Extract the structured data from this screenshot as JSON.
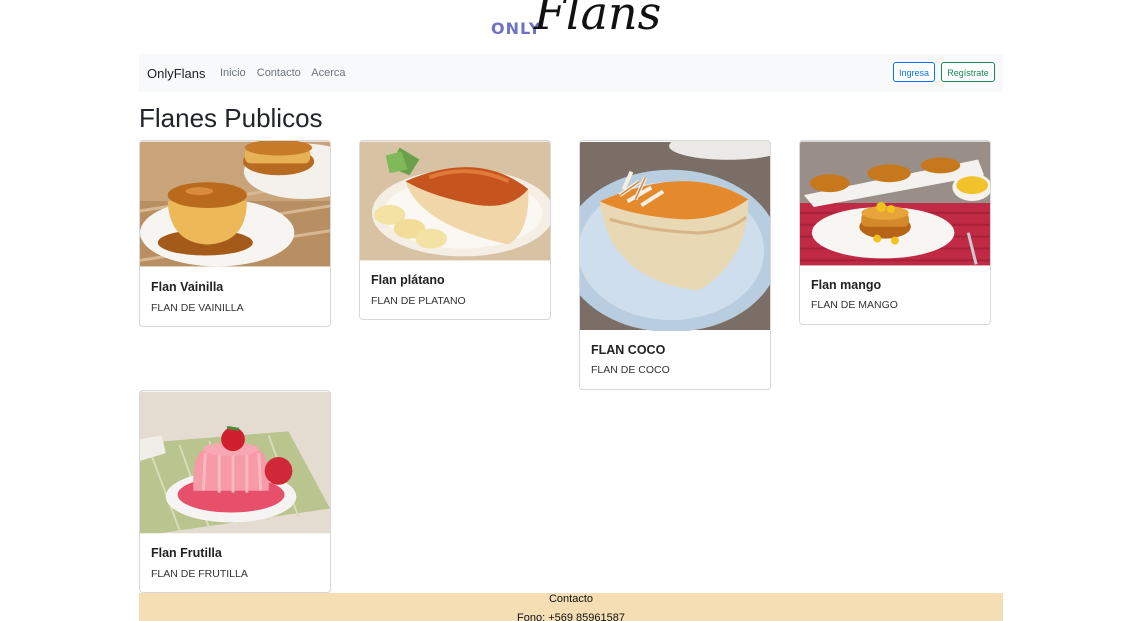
{
  "logo": {
    "only": "ONLY",
    "flans": "Flans"
  },
  "navbar": {
    "brand": "OnlyFlans",
    "links": [
      "Inicio",
      "Contacto",
      "Acerca"
    ],
    "login": "Ingresa",
    "register": "Regístrate"
  },
  "page_title": "Flanes Publicos",
  "cards": [
    {
      "title": "Flan Vainilla",
      "desc": "FLAN DE VAINILLA"
    },
    {
      "title": "Flan plátano",
      "desc": "FLAN DE PLATANO"
    },
    {
      "title": "FLAN COCO",
      "desc": "FLAN DE COCO"
    },
    {
      "title": "Flan mango",
      "desc": "FLAN DE MANGO"
    },
    {
      "title": "Flan Frutilla",
      "desc": "FLAN DE FRUTILLA"
    }
  ],
  "footer": {
    "title": "Contacto",
    "phone": "Fono: +569 85961587"
  },
  "colors": {
    "navbar_bg": "#f8f9fa",
    "footer_bg": "#f5deb3",
    "login": "#0d6efd",
    "register": "#198754",
    "logo_only": "#6f72c4"
  }
}
